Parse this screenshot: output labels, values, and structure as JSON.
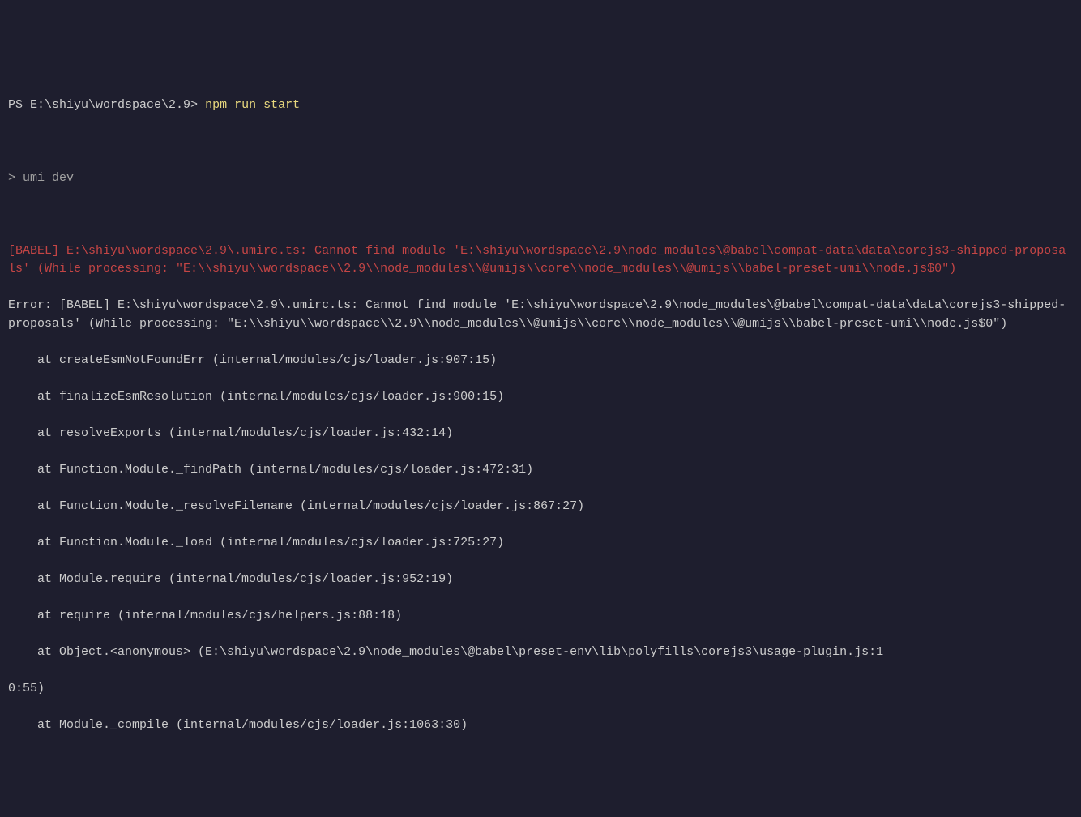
{
  "prompt": {
    "ps": "PS ",
    "path": "E:\\shiyu\\wordspace\\2.9>",
    "command": " npm run start"
  },
  "blank1": " ",
  "umi_line": "> umi dev",
  "blank2": " ",
  "babel_error": "[BABEL] E:\\shiyu\\wordspace\\2.9\\.umirc.ts: Cannot find module 'E:\\shiyu\\wordspace\\2.9\\node_modules\\@babel\\compat-data\\data\\corejs3-shipped-proposals' (While processing: \"E:\\\\shiyu\\\\wordspace\\\\2.9\\\\node_modules\\\\@umijs\\\\core\\\\node_modules\\\\@umijs\\\\babel-preset-umi\\\\node.js$0\")",
  "error_header": "Error: [BABEL] E:\\shiyu\\wordspace\\2.9\\.umirc.ts: Cannot find module 'E:\\shiyu\\wordspace\\2.9\\node_modules\\@babel\\compat-data\\data\\corejs3-shipped-proposals' (While processing: \"E:\\\\shiyu\\\\wordspace\\\\2.9\\\\node_modules\\\\@umijs\\\\core\\\\node_modules\\\\@umijs\\\\babel-preset-umi\\\\node.js$0\")",
  "stack": [
    "at createEsmNotFoundErr (internal/modules/cjs/loader.js:907:15)",
    "at finalizeEsmResolution (internal/modules/cjs/loader.js:900:15)",
    "at resolveExports (internal/modules/cjs/loader.js:432:14)",
    "at Function.Module._findPath (internal/modules/cjs/loader.js:472:31)",
    "at Function.Module._resolveFilename (internal/modules/cjs/loader.js:867:27)",
    "at Function.Module._load (internal/modules/cjs/loader.js:725:27)",
    "at Module.require (internal/modules/cjs/loader.js:952:19)",
    "at require (internal/modules/cjs/helpers.js:88:18)"
  ],
  "stack_wrap1_a": "    at Object.<anonymous> (E:\\shiyu\\wordspace\\2.9\\node_modules\\@babel\\preset-env\\lib\\polyfills\\corejs3\\usage-plugin.js:1",
  "stack_wrap1_b": "0:55)",
  "stack_last": "at Module._compile (internal/modules/cjs/loader.js:1063:30)"
}
